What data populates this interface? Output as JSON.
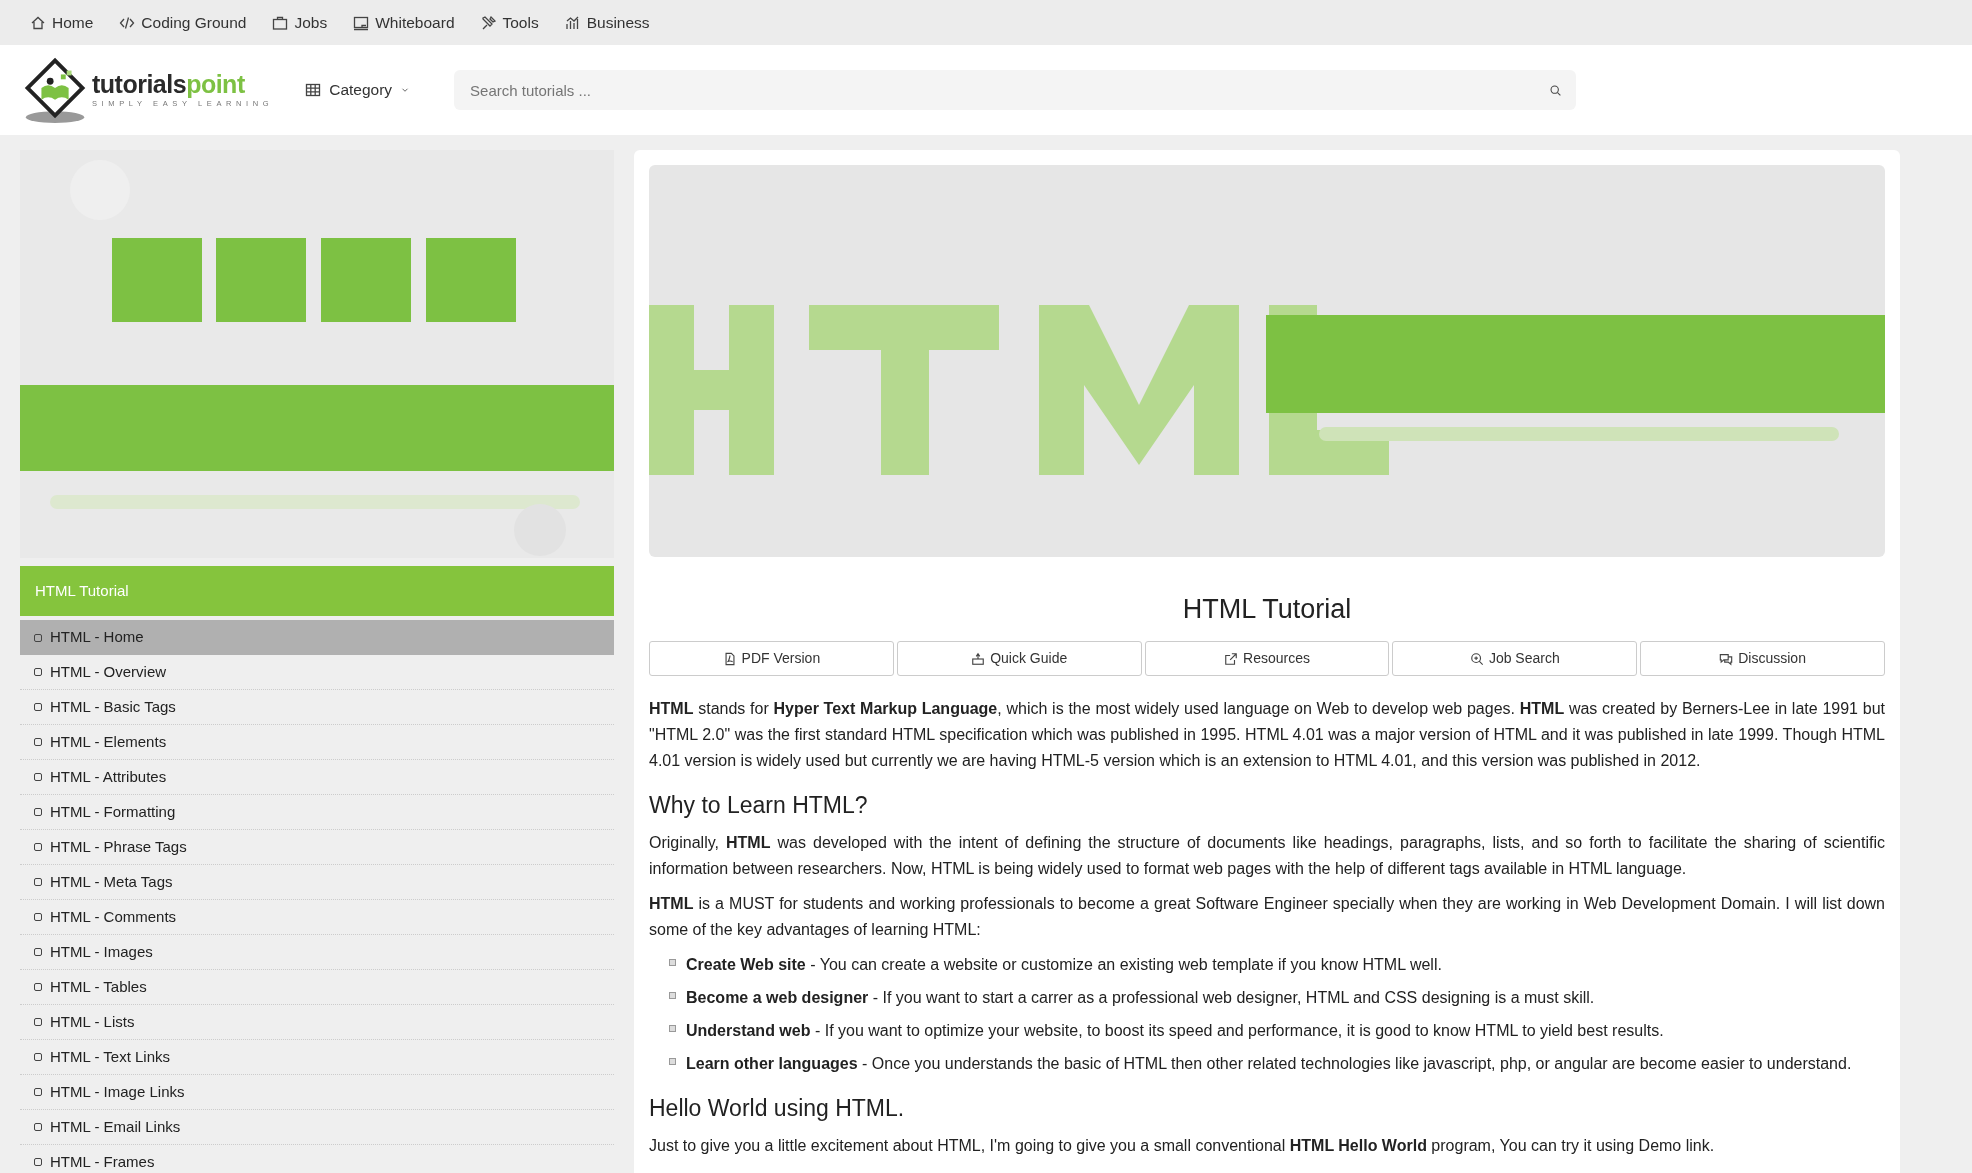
{
  "top_nav": [
    {
      "label": "Home"
    },
    {
      "label": "Coding Ground"
    },
    {
      "label": "Jobs"
    },
    {
      "label": "Whiteboard"
    },
    {
      "label": "Tools"
    },
    {
      "label": "Business"
    }
  ],
  "header": {
    "logo": {
      "word_1": "tutorials",
      "word_2": "point",
      "tagline": "SIMPLY EASY LEARNING"
    },
    "category": "Category",
    "search": {
      "placeholder": "Search tutorials ..."
    }
  },
  "sidebar": {
    "title": "HTML Tutorial",
    "items": [
      {
        "label": "HTML - Home",
        "selected": true
      },
      {
        "label": "HTML - Overview",
        "selected": false
      },
      {
        "label": "HTML - Basic Tags",
        "selected": false
      },
      {
        "label": "HTML - Elements",
        "selected": false
      },
      {
        "label": "HTML - Attributes",
        "selected": false
      },
      {
        "label": "HTML - Formatting",
        "selected": false
      },
      {
        "label": "HTML - Phrase Tags",
        "selected": false
      },
      {
        "label": "HTML - Meta Tags",
        "selected": false
      },
      {
        "label": "HTML - Comments",
        "selected": false
      },
      {
        "label": "HTML - Images",
        "selected": false
      },
      {
        "label": "HTML - Tables",
        "selected": false
      },
      {
        "label": "HTML - Lists",
        "selected": false
      },
      {
        "label": "HTML - Text Links",
        "selected": false
      },
      {
        "label": "HTML - Image Links",
        "selected": false
      },
      {
        "label": "HTML - Email Links",
        "selected": false
      },
      {
        "label": "HTML - Frames",
        "selected": false
      }
    ]
  },
  "article": {
    "title": "HTML Tutorial",
    "tools": [
      {
        "label": "PDF Version"
      },
      {
        "label": "Quick Guide"
      },
      {
        "label": "Resources"
      },
      {
        "label": "Job Search"
      },
      {
        "label": "Discussion"
      }
    ],
    "blocks": [
      {
        "kind": "paragraph",
        "text": "**HTML** stands for **Hyper Text Markup Language**, which is the most widely used language on Web to develop web pages. **HTML** was created by Berners-Lee in late 1991 but \"HTML 2.0\" was the first standard HTML specification which was published in 1995. HTML 4.01 was a major version of HTML and it was published in late 1999. Though HTML 4.01 version is widely used but currently we are having HTML-5 version which is an extension to HTML 4.01, and this version was published in 2012."
      },
      {
        "kind": "heading",
        "text": "Why to Learn HTML?"
      },
      {
        "kind": "paragraph",
        "text": "Originally, **HTML** was developed with the intent of defining the structure of documents like headings, paragraphs, lists, and so forth to facilitate the sharing of scientific information between researchers. Now, HTML is being widely used to format web pages with the help of different tags available in HTML language."
      },
      {
        "kind": "paragraph",
        "text": "**HTML** is a MUST for students and working professionals to become a great Software Engineer specially when they are working in Web Development Domain. I will list down some of the key advantages of learning HTML:"
      },
      {
        "kind": "list",
        "items": [
          "**Create Web site** - You can create a website or customize an existing web template if you know HTML well.",
          "**Become a web designer** - If you want to start a carrer as a professional web designer, HTML and CSS designing is a must skill.",
          "**Understand web** - If you want to optimize your website, to boost its speed and performance, it is good to know HTML to yield best results.",
          "**Learn other languages** - Once you understands the basic of HTML then other related technologies like javascript, php, or angular are become easier to understand."
        ]
      },
      {
        "kind": "heading",
        "text": "Hello World using HTML."
      },
      {
        "kind": "paragraph",
        "text": "Just to give you a little excitement about HTML, I'm going to give you a small conventional **HTML Hello World** program, You can try it using Demo link."
      }
    ]
  }
}
